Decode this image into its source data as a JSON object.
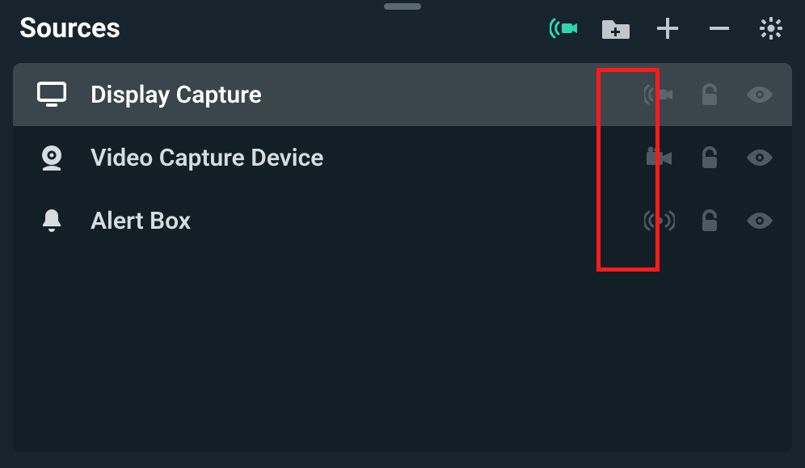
{
  "panel": {
    "title": "Sources"
  },
  "sources": [
    {
      "label": "Display Capture",
      "type": "display",
      "selected": true
    },
    {
      "label": "Video Capture Device",
      "type": "webcam",
      "selected": false
    },
    {
      "label": "Alert Box",
      "type": "alert",
      "selected": false
    }
  ],
  "highlight_column": "stream-icon"
}
